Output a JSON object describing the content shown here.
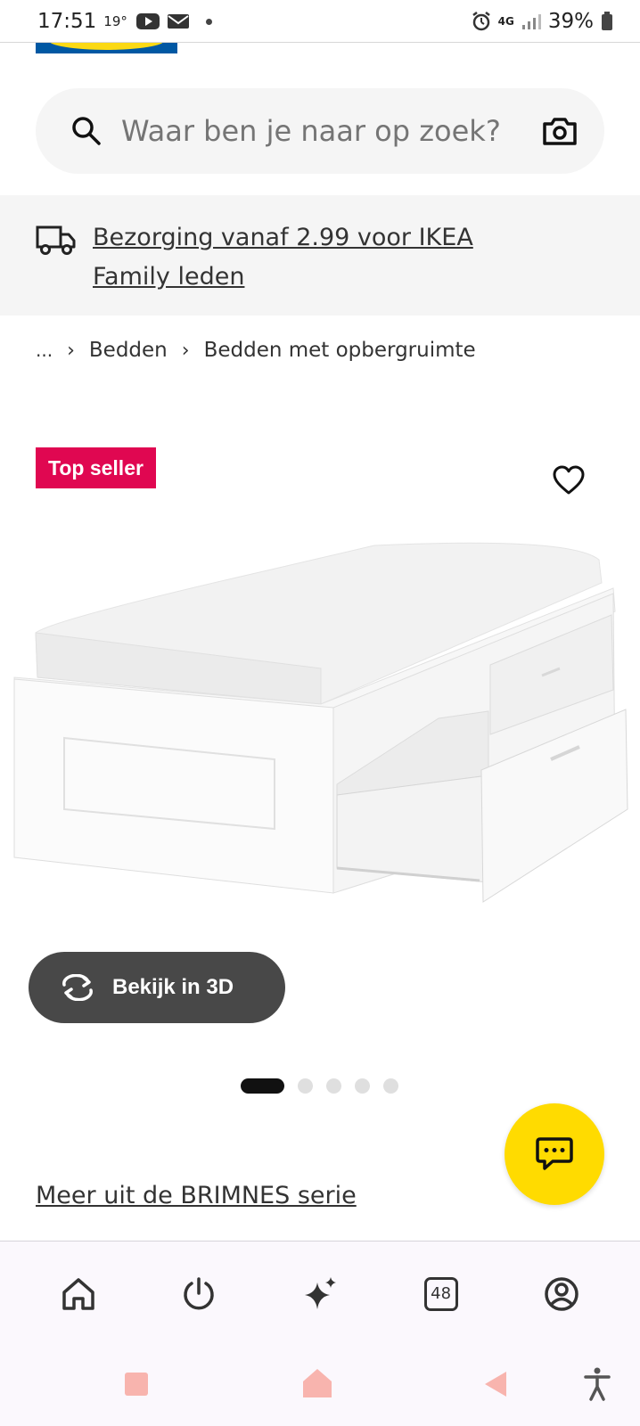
{
  "status_bar": {
    "time": "17:51",
    "temperature": "19°",
    "battery": "39%",
    "network": "4G"
  },
  "search": {
    "placeholder": "Waar ben je naar op zoek?"
  },
  "delivery_banner": {
    "text": "Bezorging vanaf 2.99 voor IKEA Family leden"
  },
  "breadcrumb": {
    "more": "...",
    "items": [
      "Bedden",
      "Bedden met opbergruimte"
    ]
  },
  "product": {
    "badge": "Top seller",
    "view_3d_label": "Bekijk in 3D",
    "series_link": "Meer uit de BRIMNES serie",
    "carousel_total": 5,
    "carousel_active": 1
  },
  "bottom_nav": {
    "tabs_count": "48"
  },
  "colors": {
    "badge": "#e00751",
    "chat_button": "#ffdb00",
    "view_3d_button": "#484848",
    "brand_blue": "#0058a3",
    "brand_yellow": "#fbd914"
  }
}
